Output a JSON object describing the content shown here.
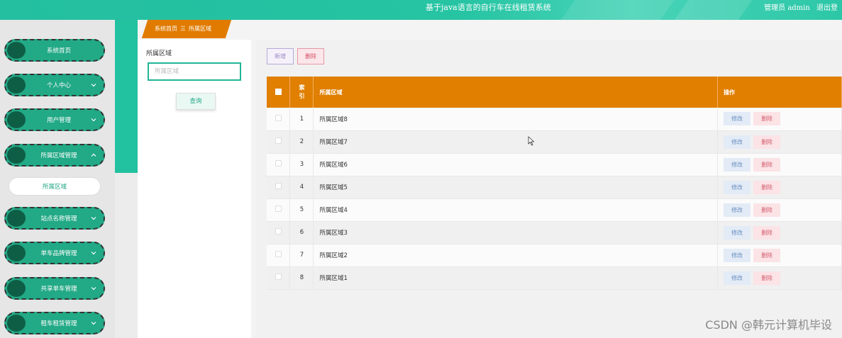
{
  "header": {
    "title": "基于java语言的自行车在线租赁系统",
    "user_label": "管理员 admin",
    "logout": "退出登"
  },
  "sidebar": {
    "items": [
      {
        "label": "系统首页",
        "has_chevron": false
      },
      {
        "label": "个人中心",
        "has_chevron": true
      },
      {
        "label": "用户管理",
        "has_chevron": true
      },
      {
        "label": "所属区域管理",
        "has_chevron": true,
        "expanded": true
      },
      {
        "label": "站点名称管理",
        "has_chevron": true
      },
      {
        "label": "单车品牌管理",
        "has_chevron": true
      },
      {
        "label": "共享单车管理",
        "has_chevron": true
      },
      {
        "label": "租车租赁管理",
        "has_chevron": true
      }
    ],
    "subitem": "所属区域"
  },
  "breadcrumb": {
    "home": "系统首页",
    "separator": "三",
    "current": "所属区域"
  },
  "search": {
    "label": "所属区域",
    "placeholder": "所属区域",
    "button": "查询"
  },
  "toolbar": {
    "add": "新增",
    "delete": "删除"
  },
  "table": {
    "headers": {
      "index": "索引",
      "name": "所属区域",
      "ops": "操作"
    },
    "rows": [
      {
        "index": "1",
        "name": "所属区域8"
      },
      {
        "index": "2",
        "name": "所属区域7"
      },
      {
        "index": "3",
        "name": "所属区域6"
      },
      {
        "index": "4",
        "name": "所属区域5"
      },
      {
        "index": "5",
        "name": "所属区域4"
      },
      {
        "index": "6",
        "name": "所属区域3"
      },
      {
        "index": "7",
        "name": "所属区域2"
      },
      {
        "index": "8",
        "name": "所属区域1"
      }
    ],
    "edit_label": "修改",
    "delete_label": "删除"
  },
  "watermark": "CSDN @韩元计算机毕设",
  "colors": {
    "primary": "#22a986",
    "header": "#26c4a3",
    "table_header": "#e07f00",
    "breadcrumb": "#e07b00"
  }
}
